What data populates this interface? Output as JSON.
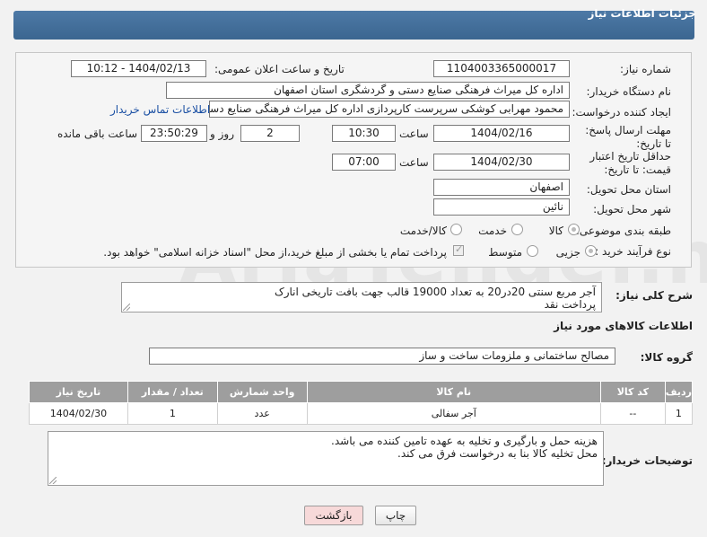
{
  "header": {
    "title": "جزئیات اطلاعات نیاز"
  },
  "form": {
    "need_number_label": "شماره نیاز:",
    "need_number": "1104003365000017",
    "announce_label": "تاریخ و ساعت اعلان عمومی:",
    "announce_value": "1404/02/13 - 10:12",
    "buyer_label": "نام دستگاه خریدار:",
    "buyer_value": "اداره کل میراث فرهنگی  صنایع دستی و گردشگری استان اصفهان",
    "creator_label": "ایجاد کننده درخواست:",
    "creator_value": "محمود مهرابی کوشکی سرپرست کارپردازی اداره کل میراث فرهنگی  صنایع دستی",
    "contact_link": "اطلاعات تماس خریدار",
    "deadline_label": "مهلت ارسال پاسخ: تا تاریخ:",
    "deadline_date": "1404/02/16",
    "time_label": "ساعت",
    "deadline_time": "10:30",
    "days_value": "2",
    "days_label": "روز و",
    "remaining_value": "23:50:29",
    "remaining_label": "ساعت باقی مانده",
    "validity_label": "حداقل تاریخ اعتبار قیمت: تا تاریخ:",
    "validity_date": "1404/02/30",
    "validity_time": "07:00",
    "province_label": "استان محل تحویل:",
    "province_value": "اصفهان",
    "city_label": "شهر محل تحویل:",
    "city_value": "نائین",
    "category_label": "طبقه بندی موضوعی:",
    "category_options": [
      "کالا",
      "خدمت",
      "کالا/خدمت"
    ],
    "process_label": "نوع فرآیند خرید :",
    "process_options": [
      "جزیی",
      "متوسط"
    ],
    "payment_note": "پرداخت تمام یا بخشی از مبلغ خرید،از محل \"اسناد خزانه اسلامی\" خواهد بود."
  },
  "description": {
    "label": "شرح کلی نیاز:",
    "text_line1": "آجر مربع سنتی 20در20 به تعداد 19000 قالب جهت بافت تاریخی انارک",
    "text_line2": "پرداخت نقد"
  },
  "goods_section": {
    "title": "اطلاعات کالاهای مورد نیاز",
    "group_label": "گروه کالا:",
    "group_value": "مصالح ساختمانی و ملزومات ساخت و ساز"
  },
  "table": {
    "headers": [
      "ردیف",
      "کد کالا",
      "نام کالا",
      "واحد شمارش",
      "تعداد / مقدار",
      "تاریخ نیاز"
    ],
    "rows": [
      [
        "1",
        "--",
        "آجر سفالی",
        "عدد",
        "1",
        "1404/02/30"
      ]
    ]
  },
  "buyer_notes": {
    "label": "توضیحات خریدار:",
    "line1": "هزینه حمل و بارگیری و تخلیه به عهده تامین کننده می باشد.",
    "line2": "محل تخلیه کالا بنا به درخواست فرق می کند."
  },
  "buttons": {
    "print": "چاپ",
    "back": "بازگشت"
  },
  "watermark": "AriaTender.neT",
  "colors": {
    "header": "#3f6a94",
    "link": "#1a4fa3",
    "table_header": "#9e9e9e",
    "back_button": "#f7d9d9"
  }
}
